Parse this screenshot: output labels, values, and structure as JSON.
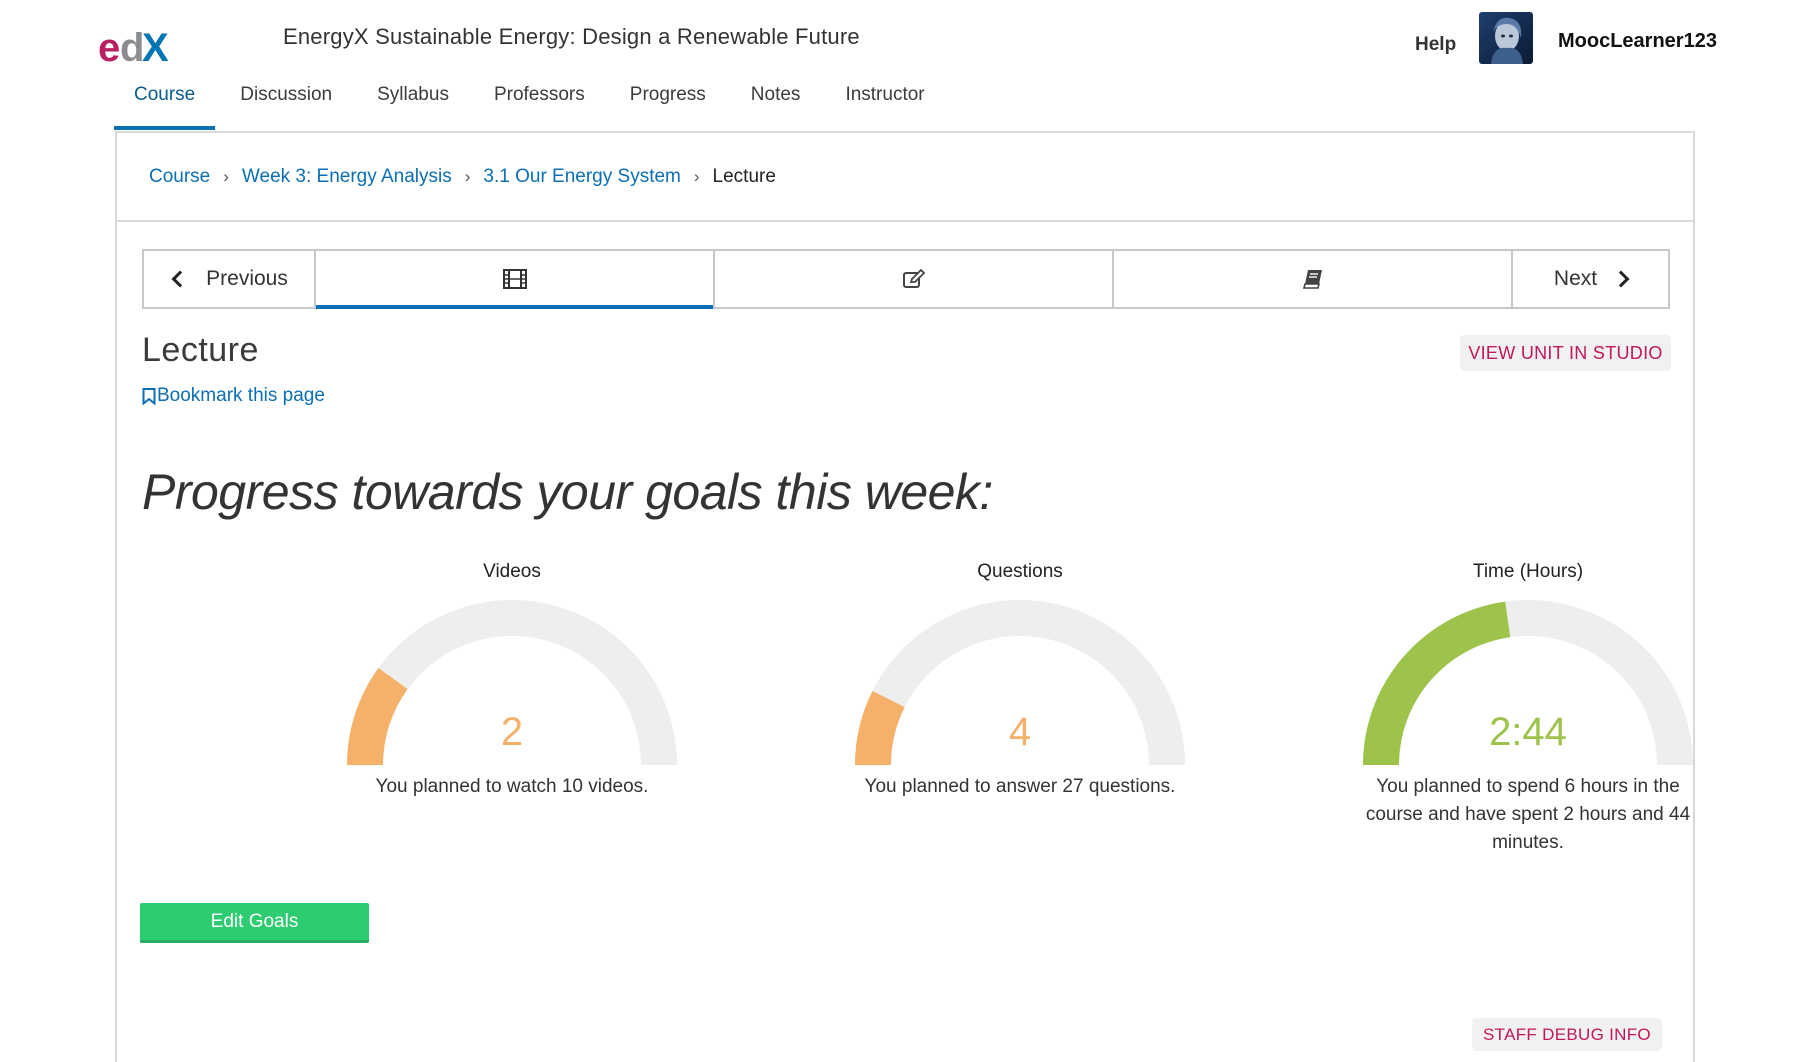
{
  "header": {
    "logo_text": "edX",
    "course_title": "EnergyX Sustainable Energy: Design a Renewable Future",
    "help": "Help",
    "username": "MoocLearner123"
  },
  "tabs": [
    {
      "label": "Course",
      "active": true
    },
    {
      "label": "Discussion"
    },
    {
      "label": "Syllabus"
    },
    {
      "label": "Professors"
    },
    {
      "label": "Progress"
    },
    {
      "label": "Notes"
    },
    {
      "label": "Instructor"
    }
  ],
  "breadcrumb": {
    "items": [
      "Course",
      "Week 3: Energy Analysis",
      "3.1 Our Energy System"
    ],
    "current": "Lecture",
    "separator": "›"
  },
  "sequence": {
    "previous": "Previous",
    "next": "Next",
    "units": [
      {
        "icon": "film-icon",
        "active": true
      },
      {
        "icon": "edit-icon"
      },
      {
        "icon": "book-icon"
      }
    ]
  },
  "unit": {
    "title": "Lecture",
    "bookmark": "Bookmark this page",
    "studio_button": "VIEW UNIT IN STUDIO"
  },
  "goals": {
    "heading": "Progress towards your goals this week:",
    "gauges": [
      {
        "label": "Videos",
        "value": "2",
        "progress": 0.2,
        "color": "#f5b06a",
        "desc": "You planned to watch 10 videos."
      },
      {
        "label": "Questions",
        "value": "4",
        "progress": 0.148,
        "color": "#f5b06a",
        "desc": "You planned to answer 27 questions."
      },
      {
        "label": "Time (Hours)",
        "value": "2:44",
        "progress": 0.456,
        "color": "#9dc34b",
        "desc": "You planned to spend 6 hours in the course and have spent 2 hours and 44 minutes."
      }
    ],
    "edit_button": "Edit Goals"
  },
  "footer": {
    "debug_button": "STAFF DEBUG INFO"
  },
  "colors": {
    "link_blue": "#0b6fb3",
    "studio_pink": "#c2175b",
    "gauge_track": "#eeeeee",
    "button_green": "#2ecc71"
  }
}
